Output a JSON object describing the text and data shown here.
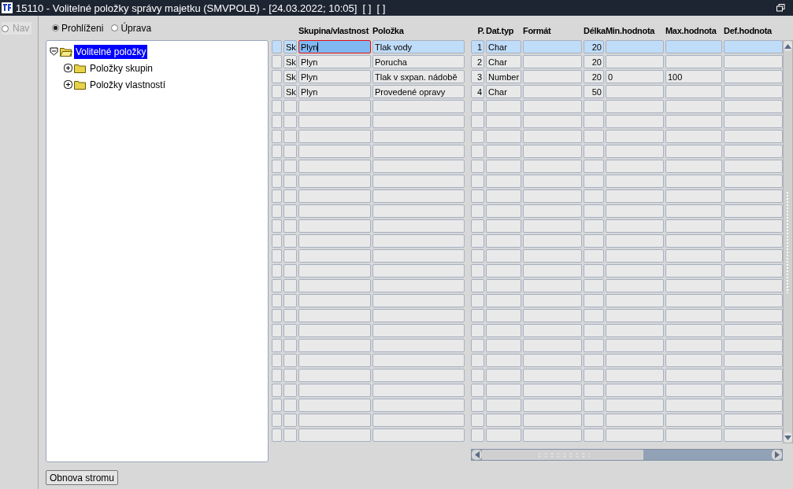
{
  "window": {
    "title": "15110 - Volitelné položky správy majetku (SMVPOLB) - [24.03.2022; 10:05]  [ ]  [ ]"
  },
  "nav": {
    "label": "Nav",
    "selected": false,
    "disabled": true
  },
  "mode": [
    {
      "label": "Prohlíženi",
      "selected": true
    },
    {
      "label": "Úprava",
      "selected": false
    }
  ],
  "tree": [
    {
      "label": "Volitelné položky",
      "expanded": true,
      "selected": true,
      "children": [
        {
          "label": "Položky skupin",
          "expanded": false,
          "selected": false
        },
        {
          "label": "Položky vlastností",
          "expanded": false,
          "selected": false
        }
      ]
    }
  ],
  "left_table": {
    "columns": [
      "",
      "",
      "Skupina/vlastnost",
      "Položka"
    ],
    "rows": [
      {
        "selected": true,
        "cells": [
          "",
          "Sk",
          "Plyn",
          "Tlak vody"
        ]
      },
      {
        "selected": false,
        "cells": [
          "",
          "Sk",
          "Plyn",
          "Porucha"
        ]
      },
      {
        "selected": false,
        "cells": [
          "",
          "Sk",
          "Plyn",
          "Tlak v sxpan. nádobě"
        ]
      },
      {
        "selected": false,
        "cells": [
          "",
          "Sk",
          "Plyn",
          "Provedené opravy"
        ]
      }
    ]
  },
  "right_table": {
    "columns": [
      "P.",
      "Dat.typ",
      "Formát",
      "Délka",
      "Min.hodnota",
      "Max.hodnota",
      "Def.hodnota"
    ],
    "rows": [
      {
        "selected": true,
        "cells": [
          "1",
          "Char",
          "",
          "20",
          "",
          "",
          ""
        ]
      },
      {
        "selected": false,
        "cells": [
          "2",
          "Char",
          "",
          "20",
          "",
          "",
          ""
        ]
      },
      {
        "selected": false,
        "cells": [
          "3",
          "Number",
          "",
          "20",
          "0",
          "100",
          ""
        ]
      },
      {
        "selected": false,
        "cells": [
          "4",
          "Char",
          "",
          "50",
          "",
          "",
          ""
        ]
      }
    ]
  },
  "refresh_button": "Obnova stromu"
}
